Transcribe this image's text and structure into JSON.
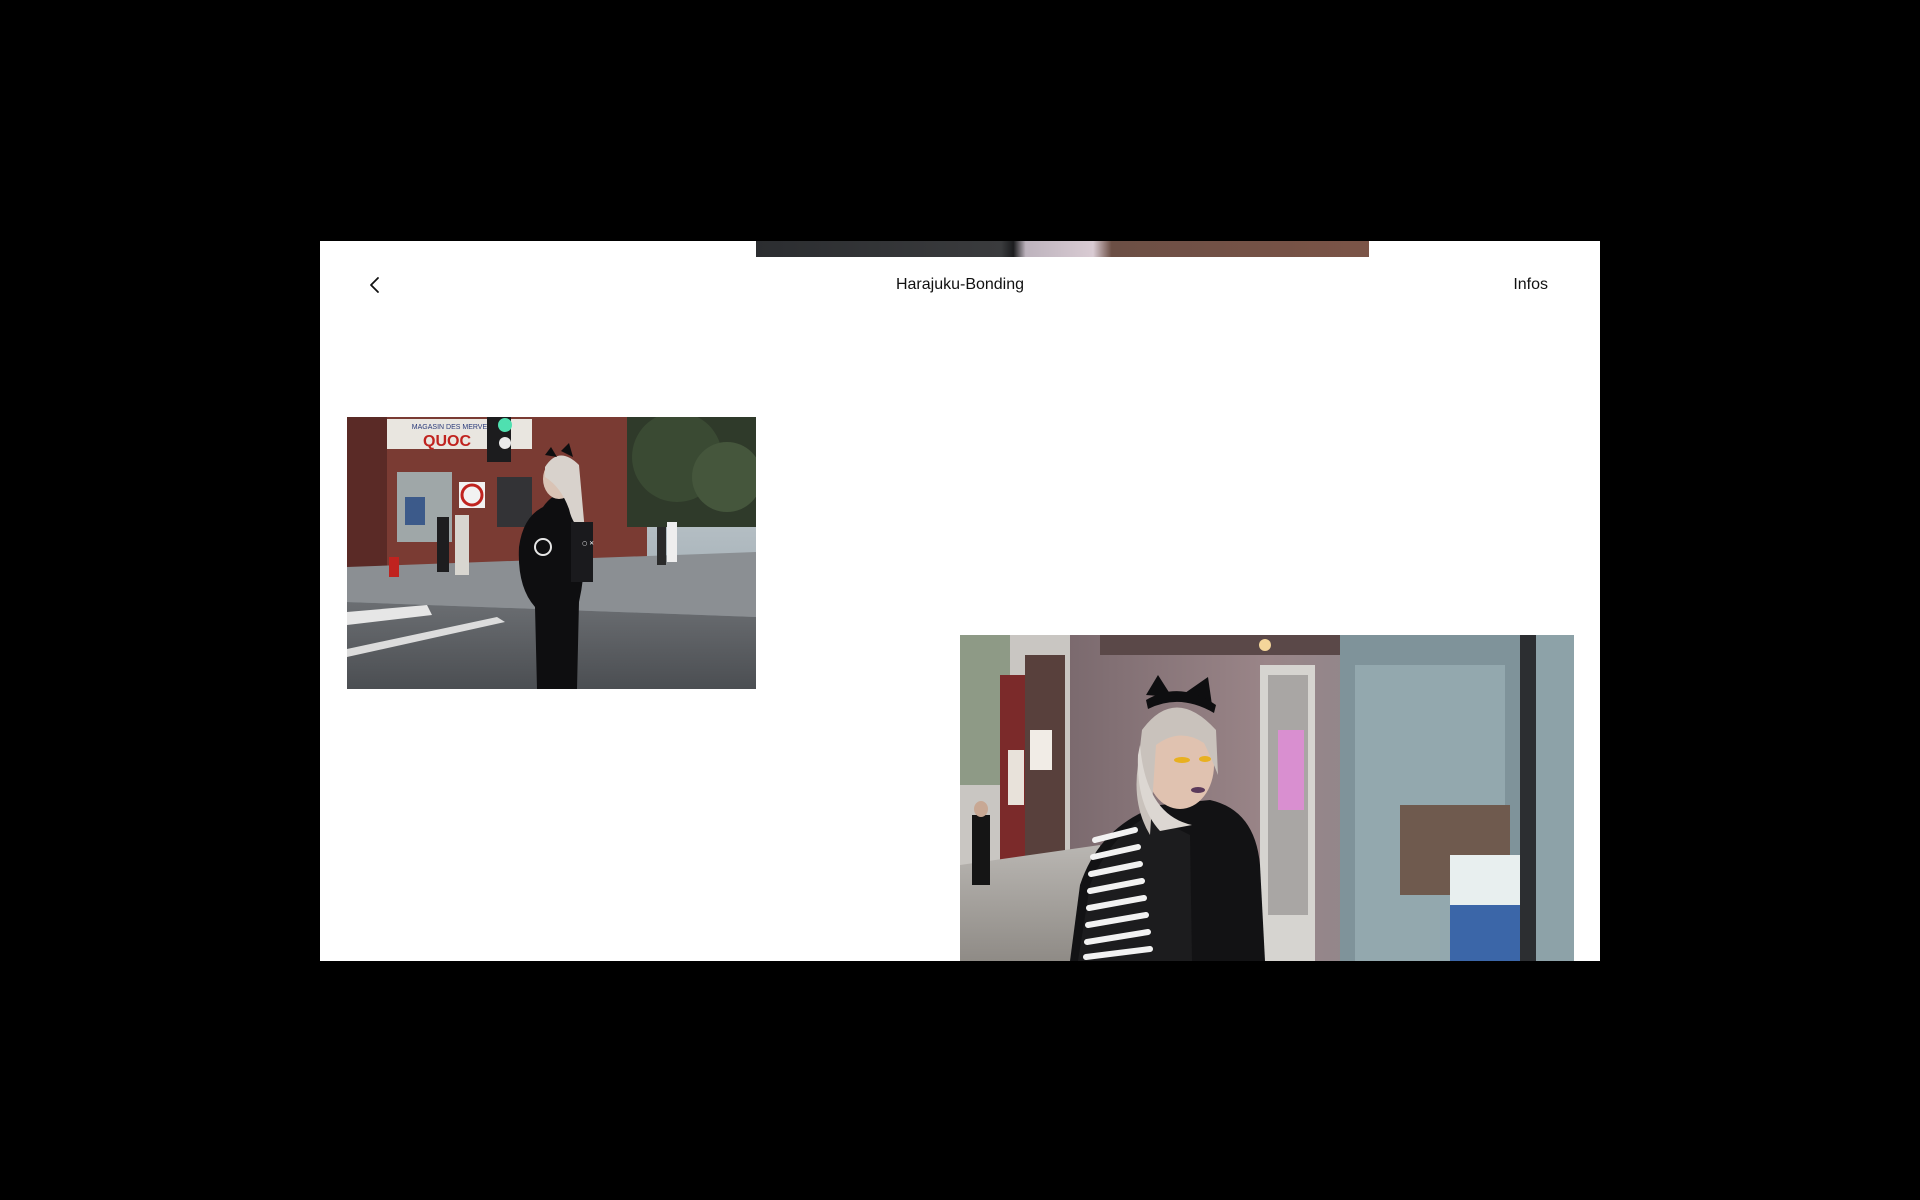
{
  "page": {
    "title": "Harajuku-Bonding",
    "infos_label": "Infos",
    "background": "#000000",
    "panel_background": "#ffffff"
  },
  "icons": {
    "back": "chevron-left-icon"
  },
  "gallery": {
    "photos": [
      {
        "id": "photo-1",
        "alt": "Woman in black jacket crossing a city street"
      },
      {
        "id": "photo-2",
        "alt": "Woman with cat-ear headband and skeleton sweater by a shop window"
      }
    ],
    "photo_1_sign_text": "QUOC",
    "photo_1_sign_small": "MAGASIN DES MERVEILLES"
  }
}
